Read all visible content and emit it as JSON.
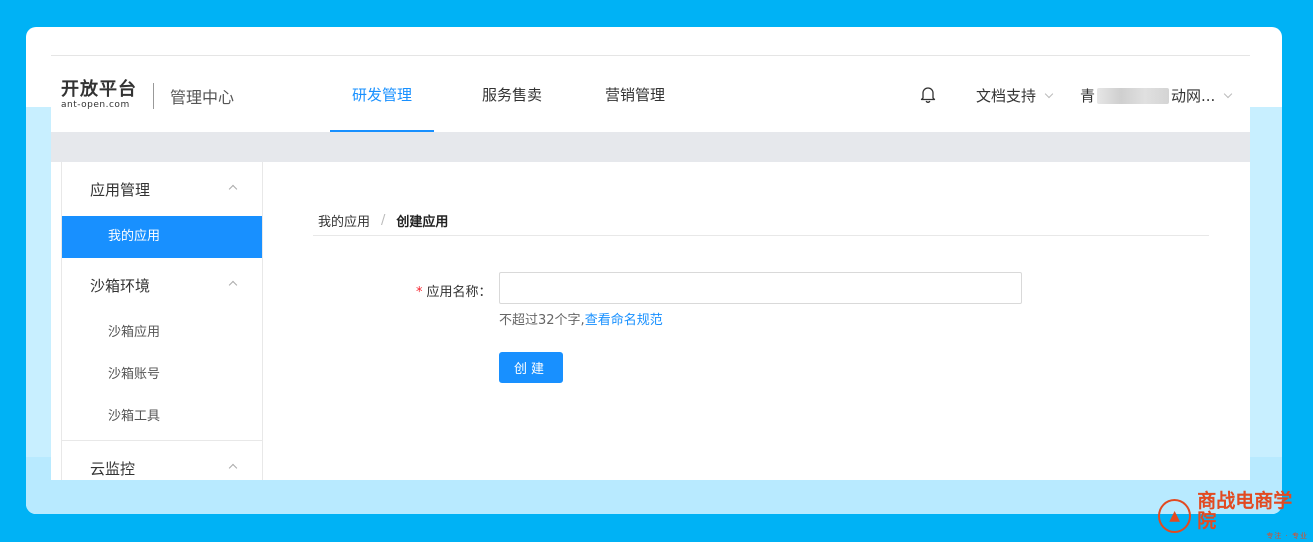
{
  "header": {
    "logo_main": "开放平台",
    "logo_sub": "ant-open.com",
    "center_title": "管理中心",
    "nav": [
      {
        "label": "研发管理",
        "active": true
      },
      {
        "label": "服务售卖",
        "active": false
      },
      {
        "label": "营销管理",
        "active": false
      }
    ],
    "doc_support": "文档支持",
    "user_prefix": "青",
    "user_suffix": "动网..."
  },
  "sidebar": {
    "groups": [
      {
        "label": "应用管理",
        "items": [
          {
            "label": "我的应用",
            "active": true
          }
        ]
      },
      {
        "label": "沙箱环境",
        "items": [
          {
            "label": "沙箱应用"
          },
          {
            "label": "沙箱账号"
          },
          {
            "label": "沙箱工具"
          }
        ]
      },
      {
        "label": "云监控",
        "items": []
      }
    ]
  },
  "breadcrumb": {
    "parent": "我的应用",
    "separator": "/",
    "current": "创建应用"
  },
  "form": {
    "required_mark": "*",
    "label": "应用名称：",
    "value": "",
    "help_text": "不超过32个字,",
    "help_link": "查看命名规范",
    "submit_label": "创建"
  },
  "watermark": {
    "text": "商战电商学院",
    "sub": "专注 · 专业"
  },
  "colors": {
    "accent": "#1890ff",
    "background": "#00b2f5",
    "required": "#f5222d"
  }
}
